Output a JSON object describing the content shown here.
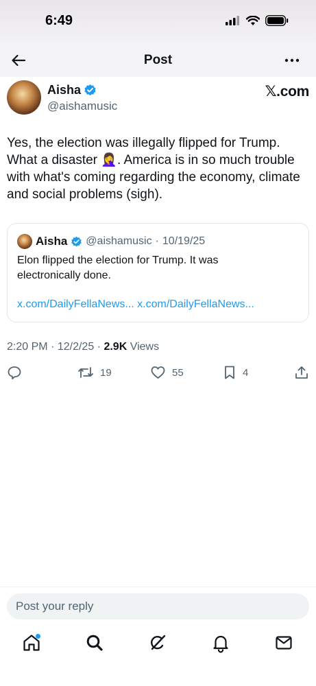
{
  "status_bar": {
    "time": "6:49"
  },
  "nav": {
    "title": "Post"
  },
  "post": {
    "author_name": "Aisha",
    "author_handle": "@aishamusic",
    "watermark": "𝕏.com",
    "text_line_1": "Yes, the election was illegally flipped for Trump.",
    "text_line_2_pre": "What a disaster ",
    "text_emoji": "🤦‍♀️",
    "text_line_2_post": ". America is in so much trouble",
    "text_line_3": "with what's coming regarding the economy, climate",
    "text_line_4": "and social problems (sigh).",
    "time": "2:20 PM",
    "date": "12/2/25",
    "views_count": "2.9K",
    "views_label": "Views",
    "separator": "·"
  },
  "quote": {
    "author_name": "Aisha",
    "author_handle": "@aishamusic",
    "date": "10/19/25",
    "separator": "·",
    "text_line_1": "Elon flipped the election for Trump. It was",
    "text_line_2": "electronically done.",
    "link_1": "x.com/DailyFellaNews...",
    "link_2": "x.com/DailyFellaNews..."
  },
  "actions": {
    "reposts": "19",
    "likes": "55",
    "bookmarks": "4"
  },
  "reply": {
    "placeholder": "Post your reply"
  },
  "colors": {
    "accent": "#1d9bf0",
    "text": "#0f1419",
    "secondary": "#536471"
  },
  "icons": {
    "back": "arrow-left-icon",
    "more": "more-horizontal-icon",
    "verified": "verified-badge-icon",
    "reply": "reply-icon",
    "repost": "repost-icon",
    "like": "heart-icon",
    "bookmark": "bookmark-icon",
    "share": "share-icon",
    "home": "home-icon",
    "search": "search-icon",
    "grok": "grok-icon",
    "notifications": "bell-icon",
    "messages": "mail-icon"
  }
}
